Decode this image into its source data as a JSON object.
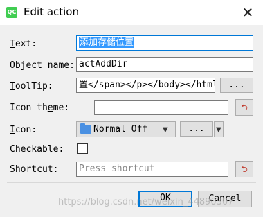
{
  "window": {
    "title": "Edit action",
    "app_icon_text": "QC"
  },
  "form": {
    "text": {
      "label": "Text:",
      "value": "添加存储位置"
    },
    "object_name": {
      "label": "Object name:",
      "value": "actAddDir"
    },
    "tooltip": {
      "label": "ToolTip:",
      "value": "置</span></p></body></html>",
      "more_label": "..."
    },
    "icon_theme": {
      "label": "Icon theme:",
      "value": ""
    },
    "icon": {
      "label": "Icon:",
      "selected": "Normal Off",
      "more_label": "..."
    },
    "checkable": {
      "label": "Checkable:",
      "checked": false
    },
    "shortcut": {
      "label": "Shortcut:",
      "placeholder": "Press shortcut"
    }
  },
  "buttons": {
    "ok_label": "OK",
    "cancel_label": "Cancel"
  },
  "watermark": "https://blog.csdn.net/weixin_44890307",
  "colors": {
    "selection": "#3399ff",
    "focus_border": "#0078d7",
    "dialog_bg": "#f0f0f0",
    "folder_icon": "#4a90e2"
  },
  "icons": [
    "qt-app-icon",
    "close-icon",
    "reset-icon",
    "folder-icon",
    "dropdown-arrow-icon"
  ]
}
